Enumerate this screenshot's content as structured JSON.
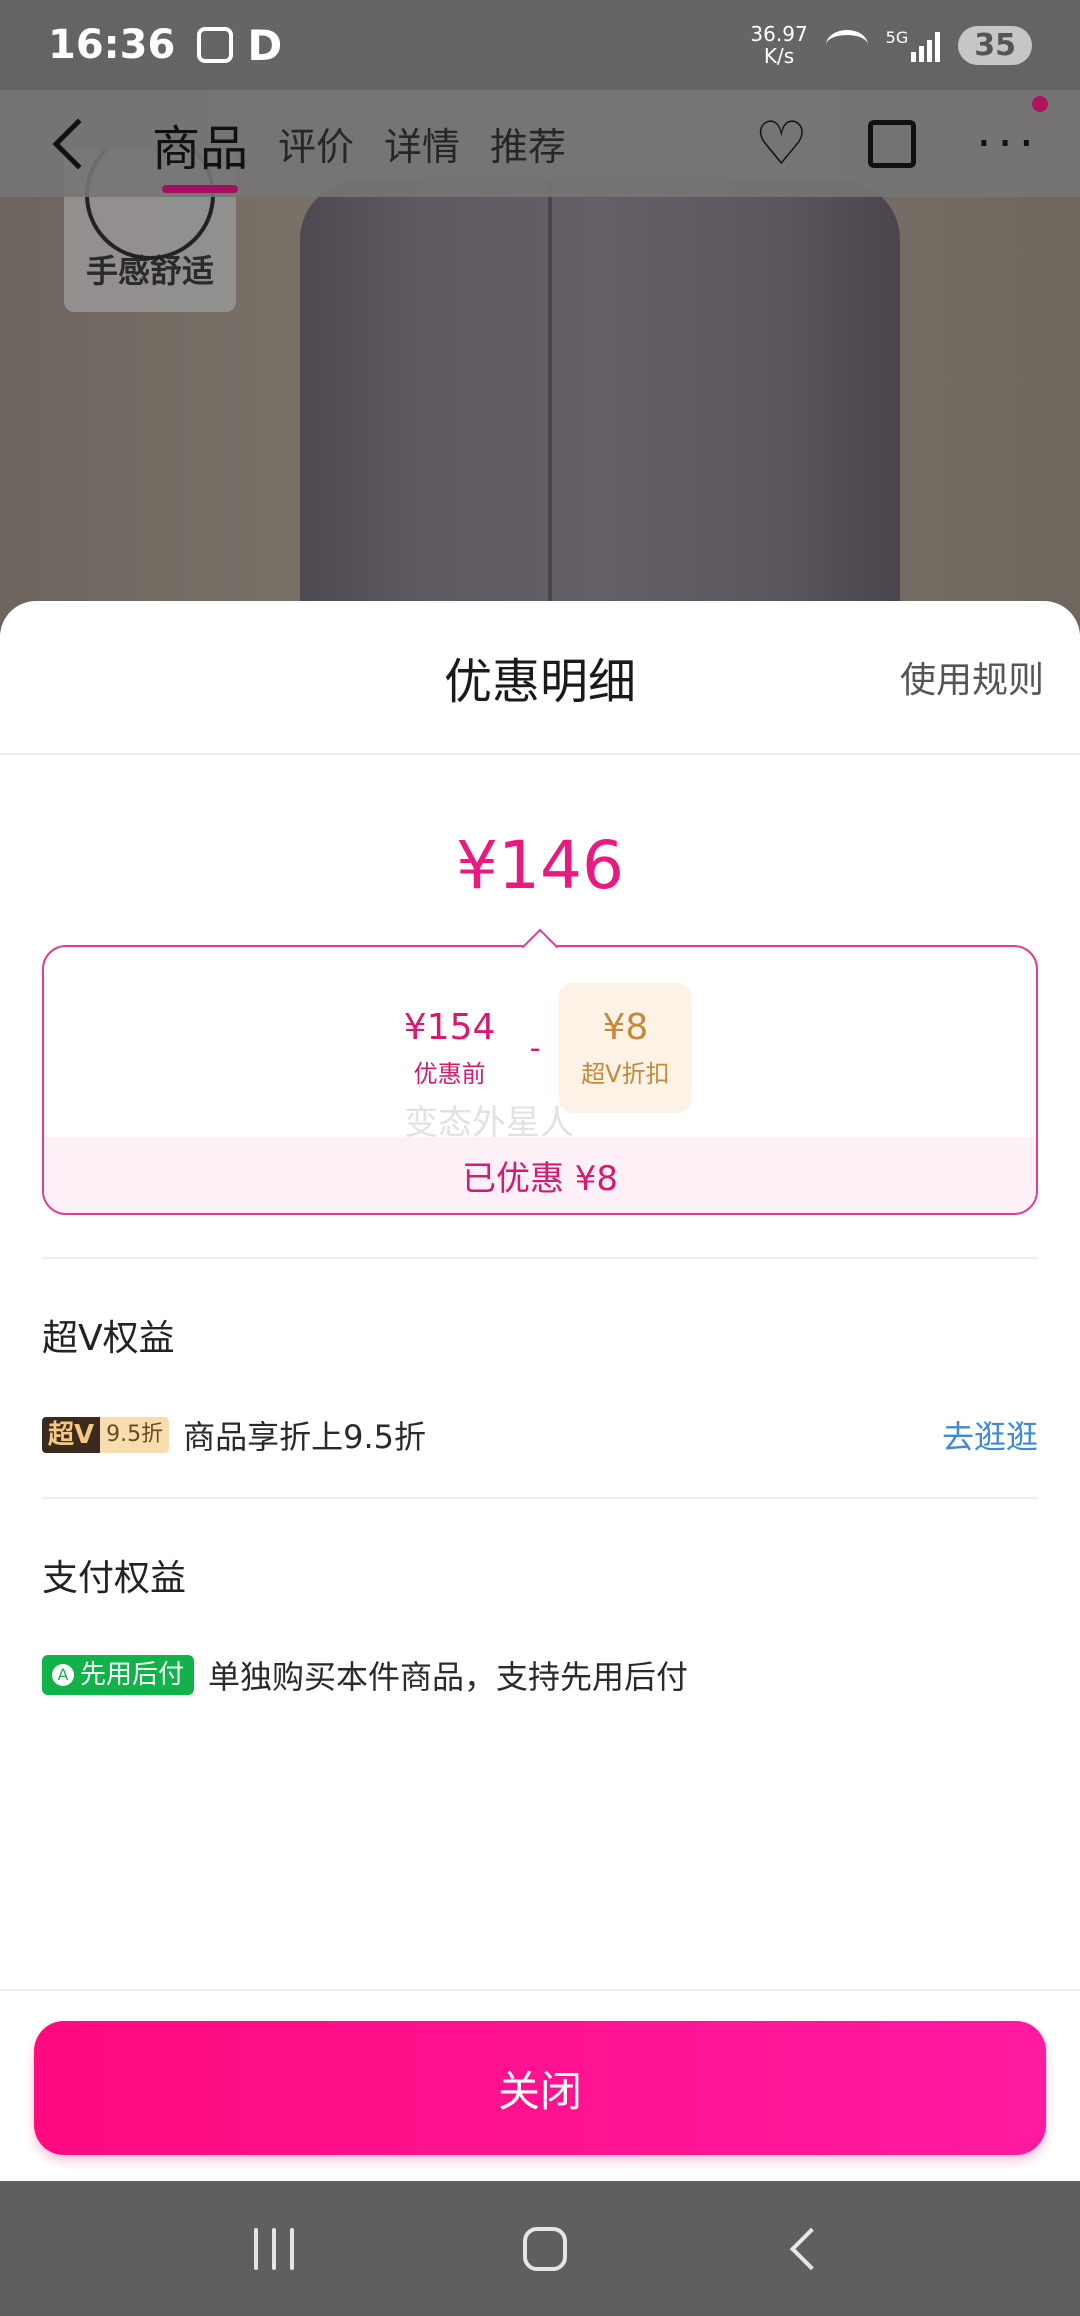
{
  "status_bar": {
    "time": "16:36",
    "d_glyph": "D",
    "speed_value": "36.97",
    "speed_unit": "K/s",
    "network": "5G",
    "battery": "35"
  },
  "product_page": {
    "tabs": [
      "商品",
      "评价",
      "详情",
      "推荐"
    ],
    "active_tab": "商品",
    "feature_tag": "手感舒适"
  },
  "sheet": {
    "title": "优惠明细",
    "rules_link": "使用规则",
    "final_price": "¥146",
    "breakdown": {
      "original_amount": "¥154",
      "original_label": "优惠前",
      "minus": "-",
      "discount_amount": "¥8",
      "discount_label": "超V折扣",
      "watermark": "变态外星人",
      "saved_text": "已优惠 ¥8"
    },
    "super_v_section": {
      "title": "超V权益",
      "badge_main": "超V",
      "badge_rate": "9.5折",
      "text": "商品享折上9.5折",
      "link": "去逛逛"
    },
    "payment_section": {
      "title": "支付权益",
      "badge_icon": "A",
      "badge": "先用后付",
      "text": "单独购买本件商品，支持先用后付"
    },
    "close_button": "关闭"
  },
  "colors": {
    "accent_pink": "#e8197f",
    "gold": "#c48a3a",
    "link_blue": "#3e8ad4",
    "pay_green": "#12b24a"
  }
}
